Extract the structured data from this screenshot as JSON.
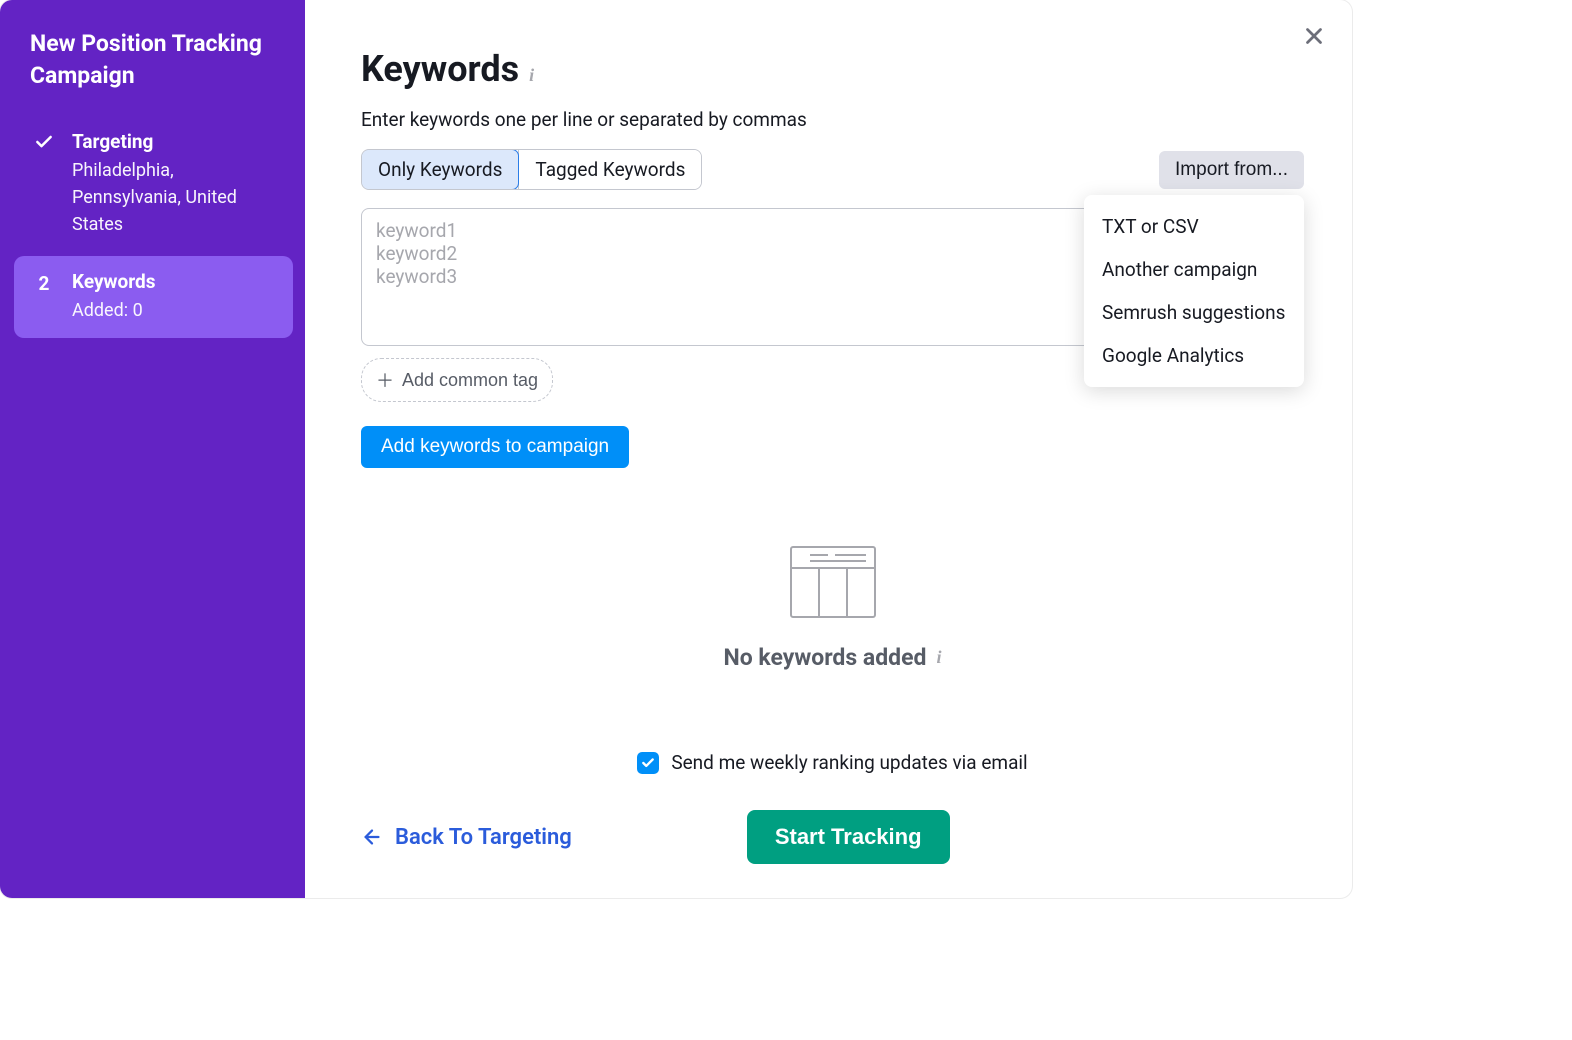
{
  "sidebar": {
    "title": "New Position Tracking Campaign",
    "steps": [
      {
        "label": "Targeting",
        "sub": "Philadelphia, Pennsylvania, United States",
        "completed": true
      },
      {
        "number": "2",
        "label": "Keywords",
        "sub": "Added: 0",
        "active": true
      }
    ]
  },
  "main": {
    "title": "Keywords",
    "subtitle": "Enter keywords one per line or separated by commas",
    "tabs": {
      "only": "Only Keywords",
      "tagged": "Tagged Keywords"
    },
    "import": {
      "button": "Import from...",
      "options": [
        "TXT or CSV",
        "Another campaign",
        "Semrush suggestions",
        "Google Analytics"
      ]
    },
    "textarea_placeholder": "keyword1\nkeyword2\nkeyword3",
    "add_tag_label": "Add common tag",
    "add_keywords_button": "Add keywords to campaign",
    "empty_state": "No keywords added",
    "weekly_checkbox": {
      "checked": true,
      "label": "Send me weekly ranking updates via email"
    },
    "back_button": "Back To Targeting",
    "start_button": "Start Tracking"
  }
}
